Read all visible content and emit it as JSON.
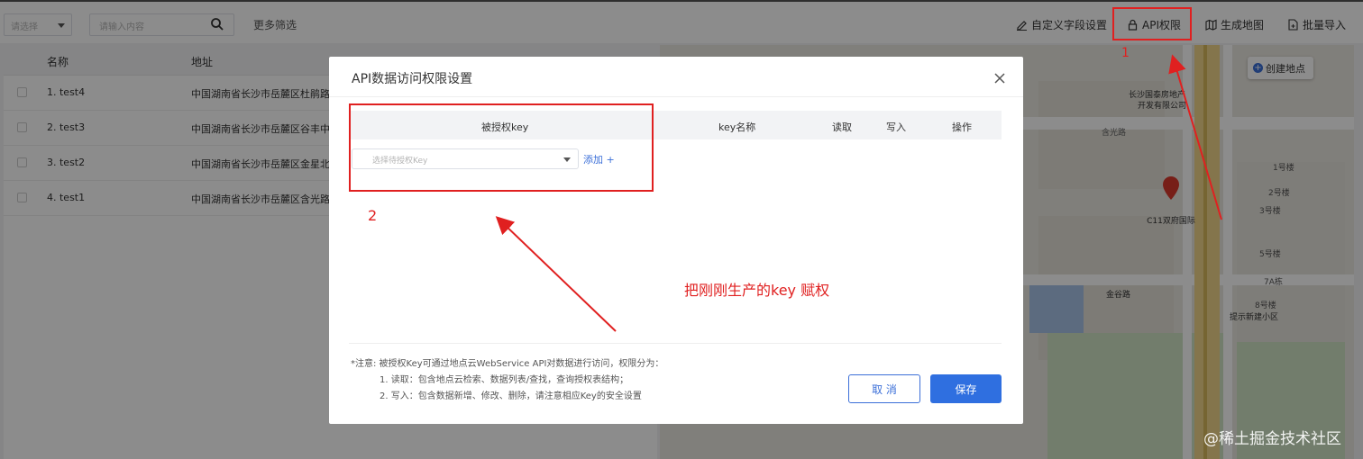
{
  "toolbar": {
    "select_placeholder": "请选择",
    "search_placeholder": "请输入内容",
    "more_filters": "更多筛选",
    "custom_fields": "自定义字段设置",
    "api_permission": "API权限",
    "generate_map": "生成地图",
    "batch_import": "批量导入"
  },
  "table": {
    "columns": [
      "名称",
      "地址"
    ],
    "rows": [
      {
        "name": "1. test4",
        "address": "中国湖南省长沙市岳麓区杜鹃路"
      },
      {
        "name": "2. test3",
        "address": "中国湖南省长沙市岳麓区谷丰中"
      },
      {
        "name": "3. test2",
        "address": "中国湖南省长沙市岳麓区金星北"
      },
      {
        "name": "4. test1",
        "address": "中国湖南省长沙市岳麓区含光路"
      }
    ]
  },
  "map": {
    "create_button": "创建地点",
    "labels": [
      "长沙国泰房地产开发有限公司",
      "C11双府国际",
      "含光路",
      "金谷路",
      "提示新建小区",
      "1号楼",
      "2号楼",
      "3号楼",
      "5号楼",
      "7A栋",
      "8号楼"
    ]
  },
  "modal": {
    "title": "API数据访问权限设置",
    "columns": {
      "authorized_key": "被授权key",
      "key_name": "key名称",
      "read": "读取",
      "write": "写入",
      "actions": "操作"
    },
    "key_select_placeholder": "选择待授权Key",
    "add_label": "添加 +",
    "note_line1": "*注意: 被授权Key可通过地点云WebService API对数据进行访问，权限分为：",
    "note_line2": "1. 读取：包含地点云检索、数据列表/查找，查询授权表结构；",
    "note_line3": "2. 写入：包含数据新增、修改、删除，请注意相应Key的安全设置",
    "cancel_label": "取 消",
    "save_label": "保存"
  },
  "annotations": {
    "marker_1": "1",
    "marker_2": "2",
    "instruction": "把刚刚生产的key  赋权"
  },
  "watermark": "@稀土掘金技术社区",
  "colors": {
    "primary": "#2f6fe0",
    "annotation_red": "#e02020",
    "overlay": "rgba(0,0,0,0.45)"
  }
}
